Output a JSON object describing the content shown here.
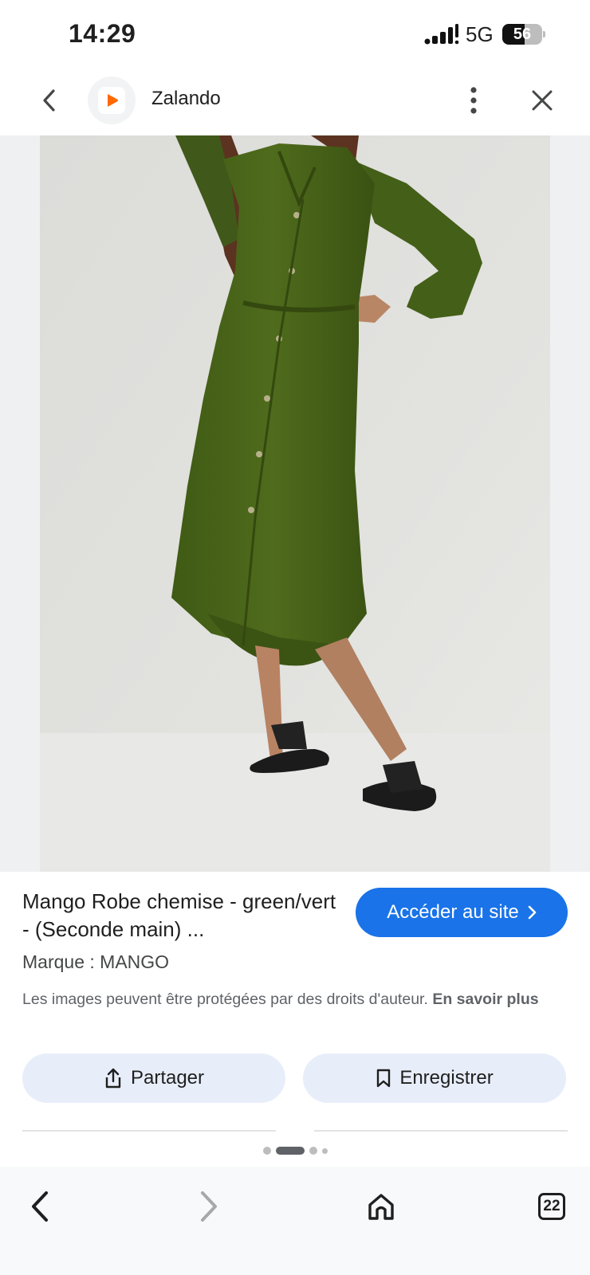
{
  "status_bar": {
    "time": "14:29",
    "network": "5G",
    "battery_percent": "56",
    "battery_level": 0.56,
    "icons": [
      "signal-bars-icon",
      "battery-icon"
    ]
  },
  "header": {
    "site_name": "Zalando",
    "logo_color": "#ff6900",
    "icons": [
      "back-arrow-icon",
      "more-vert-icon",
      "close-icon"
    ]
  },
  "product": {
    "title": "Mango Robe chemise - green/vert - (Seconde main) ...",
    "brand": "Marque : MANGO",
    "image_icon": "green-shirt-dress-photo"
  },
  "cta": {
    "label": "Accéder au site",
    "color": "#1a73e8",
    "icon": "chevron-right-icon"
  },
  "copyright": {
    "text": "Les images peuvent être protégées par des droits d'auteur.",
    "link": "En savoir plus"
  },
  "actions": {
    "share_label": "Partager",
    "share_icon": "share-icon",
    "save_label": "Enregistrer",
    "save_icon": "bookmark-icon"
  },
  "pager": {
    "count": 4,
    "active_index": 1
  },
  "bottom_nav": {
    "tab_count": "22",
    "icons": [
      "nav-back-icon",
      "nav-forward-icon",
      "home-icon",
      "tabs-icon"
    ]
  }
}
